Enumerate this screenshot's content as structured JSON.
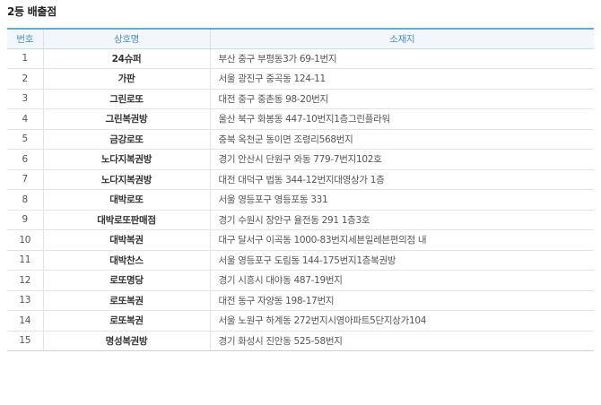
{
  "title": "2등 배출점",
  "headers": {
    "no": "번호",
    "name": "상호명",
    "addr": "소재지"
  },
  "rows": [
    {
      "no": "1",
      "name": "24슈퍼",
      "addr": "부산 중구 부평동3가 69-1번지"
    },
    {
      "no": "2",
      "name": "가판",
      "addr": "서울 광진구 중곡동 124-11"
    },
    {
      "no": "3",
      "name": "그린로또",
      "addr": "대전 중구 중촌동 98-20번지"
    },
    {
      "no": "4",
      "name": "그린복권방",
      "addr": "울산 북구 화봉동 447-10번지1층그린플라워"
    },
    {
      "no": "5",
      "name": "금강로또",
      "addr": "충북 옥천군 동이면 조령리568번지"
    },
    {
      "no": "6",
      "name": "노다지복권방",
      "addr": "경기 안산시 단원구 와동 779-7번지102호"
    },
    {
      "no": "7",
      "name": "노다지복권방",
      "addr": "대전 대덕구 법동 344-12번지대영상가 1층"
    },
    {
      "no": "8",
      "name": "대박로또",
      "addr": "서울 영등포구 영등포동 331"
    },
    {
      "no": "9",
      "name": "대박로또판매점",
      "addr": "경기 수원시 장안구 율전동 291 1층3호"
    },
    {
      "no": "10",
      "name": "대박복권",
      "addr": "대구 달서구 이곡동 1000-83번지세븐일레븐편의점 내"
    },
    {
      "no": "11",
      "name": "대박찬스",
      "addr": "서울 영등포구 도림동 144-175번지1층복권방"
    },
    {
      "no": "12",
      "name": "로또명당",
      "addr": "경기 시흥시 대야동 487-19번지"
    },
    {
      "no": "13",
      "name": "로또복권",
      "addr": "대전 동구 자양동 198-17번지"
    },
    {
      "no": "14",
      "name": "로또복권",
      "addr": "서울 노원구 하계동 272번지시영아파트5단지상가104"
    },
    {
      "no": "15",
      "name": "명성복권방",
      "addr": "경기 화성시 진안동 525-58번지"
    }
  ]
}
